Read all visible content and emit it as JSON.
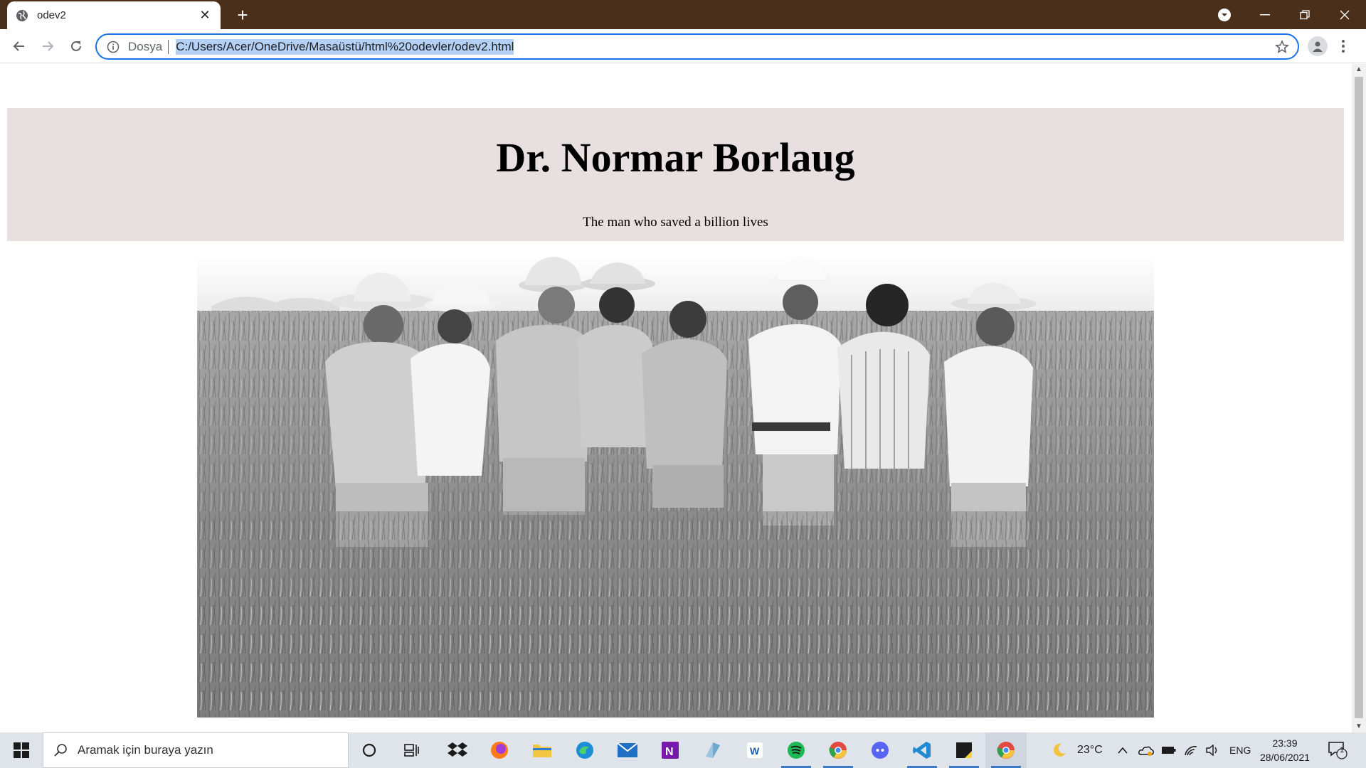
{
  "browser": {
    "tab_title": "odev2",
    "new_tab": "+",
    "omnibox": {
      "scheme_label": "Dosya",
      "url": "C:/Users/Acer/OneDrive/Masaüstü/html%20odevler/odev2.html"
    }
  },
  "page": {
    "title": "Dr. Normar Borlaug",
    "subtitle": "The man who saved a billion lives",
    "header_background": "#e8dfe1",
    "photo": {
      "style": "black-and-white",
      "subject": "eight men standing in a wheat field"
    }
  },
  "taskbar": {
    "search_placeholder": "Aramak için buraya yazın",
    "pinned_icons": [
      "cortana-icon",
      "task-view-icon",
      "dropbox-icon",
      "firefox-icon",
      "file-explorer-icon",
      "edge-icon",
      "mail-icon",
      "onenote-icon",
      "app-icon",
      "ms-store-icon",
      "spotify-icon",
      "chrome-icon",
      "discord-icon",
      "vscode-icon",
      "sticky-notes-icon",
      "chrome-active-icon"
    ],
    "weather": "23°C",
    "language": "ENG",
    "time": "23:39",
    "date": "28/06/2021",
    "notification_count": "1"
  },
  "colors": {
    "titlebar": "#4a2f1a",
    "omnibox_focus": "#1a73e8",
    "url_selection": "#b4d0f5"
  }
}
